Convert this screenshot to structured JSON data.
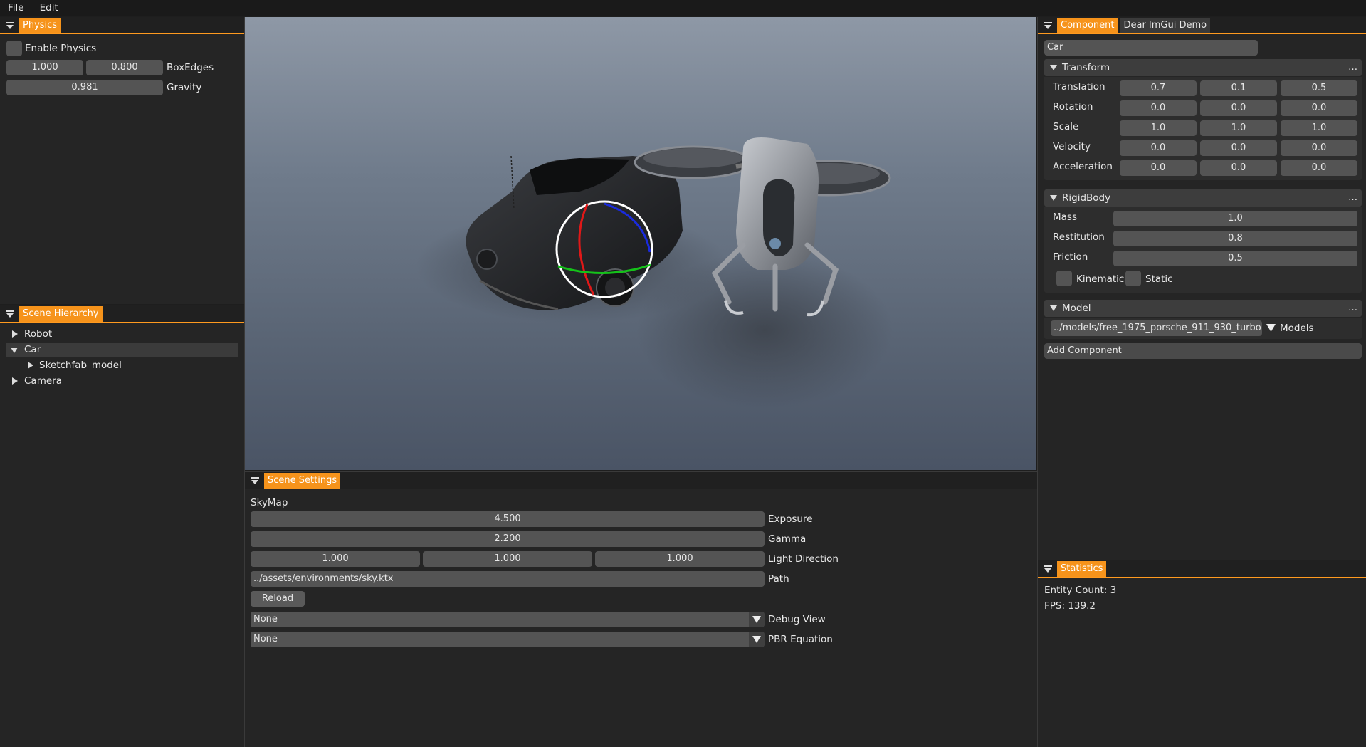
{
  "menu": {
    "file": "File",
    "edit": "Edit"
  },
  "physics": {
    "tab": "Physics",
    "enable_label": "Enable Physics",
    "box_edges_values": [
      "1.000",
      "0.800"
    ],
    "box_edges_label": "BoxEdges",
    "gravity_value": "0.981",
    "gravity_label": "Gravity"
  },
  "hierarchy": {
    "tab": "Scene Hierarchy",
    "items": [
      {
        "label": "Robot"
      },
      {
        "label": "Car"
      },
      {
        "label": "Sketchfab_model"
      },
      {
        "label": "Camera"
      }
    ]
  },
  "scene_settings": {
    "tab": "Scene Settings",
    "skymap_label": "SkyMap",
    "exposure_value": "4.500",
    "exposure_label": "Exposure",
    "gamma_value": "2.200",
    "gamma_label": "Gamma",
    "light_dir_values": [
      "1.000",
      "1.000",
      "1.000"
    ],
    "light_dir_label": "Light Direction",
    "path_value": "../assets/environments/sky.ktx",
    "path_label": "Path",
    "reload_label": "Reload",
    "debug_view_value": "None",
    "debug_view_label": "Debug View",
    "pbr_value": "None",
    "pbr_label": "PBR Equation"
  },
  "component": {
    "tab_active": "Component",
    "tab_inactive": "Dear ImGui Demo",
    "entity_name": "Car",
    "transform": {
      "title": "Transform",
      "more": "...",
      "rows": [
        {
          "label": "Translation",
          "values": [
            "0.7",
            "0.1",
            "0.5"
          ]
        },
        {
          "label": "Rotation",
          "values": [
            "0.0",
            "0.0",
            "0.0"
          ]
        },
        {
          "label": "Scale",
          "values": [
            "1.0",
            "1.0",
            "1.0"
          ]
        },
        {
          "label": "Velocity",
          "values": [
            "0.0",
            "0.0",
            "0.0"
          ]
        },
        {
          "label": "Acceleration",
          "values": [
            "0.0",
            "0.0",
            "0.0"
          ]
        }
      ]
    },
    "rigidbody": {
      "title": "RigidBody",
      "more": "...",
      "rows": [
        {
          "label": "Mass",
          "value": "1.0"
        },
        {
          "label": "Restitution",
          "value": "0.8"
        },
        {
          "label": "Friction",
          "value": "0.5"
        }
      ],
      "kinematic_label": "Kinematic",
      "static_label": "Static"
    },
    "model": {
      "title": "Model",
      "more": "...",
      "path": "../models/free_1975_porsche_911_930_turbo",
      "models_label": "Models"
    },
    "add_component_label": "Add Component"
  },
  "statistics": {
    "tab": "Statistics",
    "entity_count": "Entity Count: 3",
    "fps": "FPS: 139.2"
  },
  "colors": {
    "accent": "#f6931b",
    "panel": "#252525",
    "field": "#545454"
  }
}
